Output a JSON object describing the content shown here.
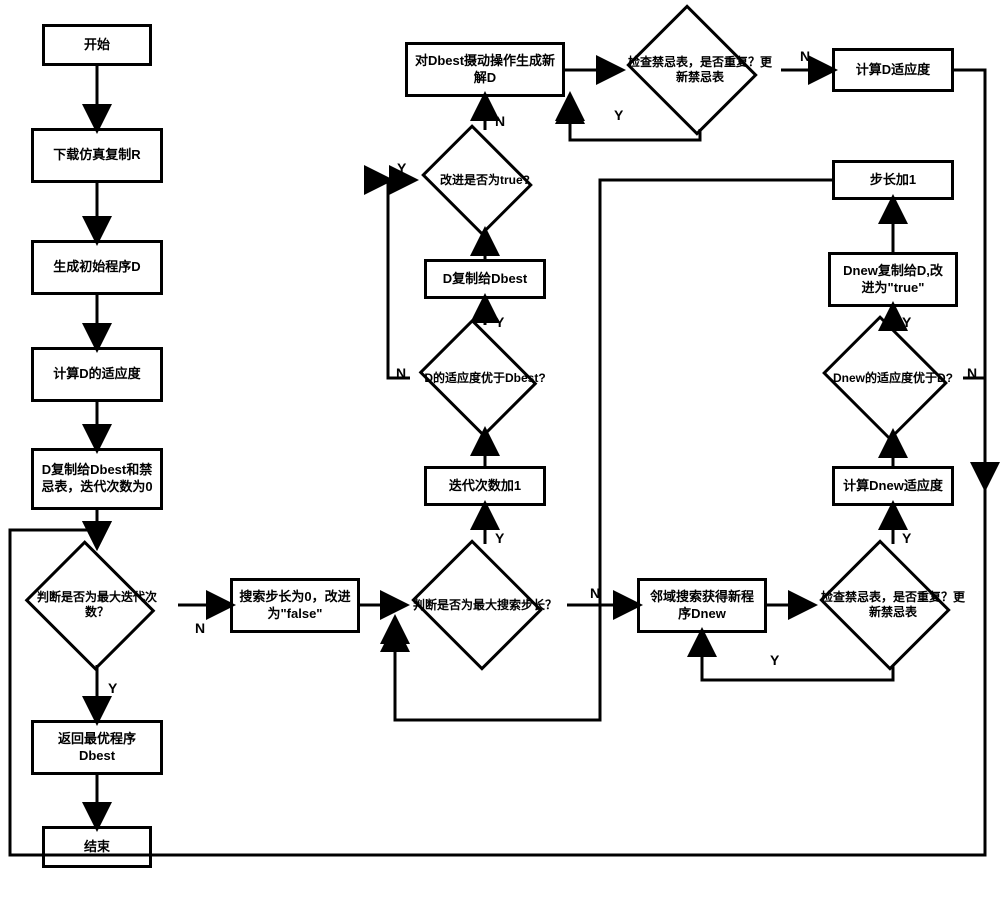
{
  "chart_data": {
    "type": "flowchart",
    "title": "",
    "nodes": [
      {
        "id": "n1",
        "shape": "rect",
        "label": "开始"
      },
      {
        "id": "n2",
        "shape": "rect",
        "label": "下载仿真复制R"
      },
      {
        "id": "n3",
        "shape": "rect",
        "label": "生成初始程序D"
      },
      {
        "id": "n4",
        "shape": "rect",
        "label": "计算D的适应度"
      },
      {
        "id": "n5",
        "shape": "rect",
        "label": "D复制给Dbest和禁忌表，迭代次数为0"
      },
      {
        "id": "n6",
        "shape": "diamond",
        "label": "判断是否为最大迭代次数？"
      },
      {
        "id": "n7",
        "shape": "rect",
        "label": "返回最优程序Dbest"
      },
      {
        "id": "n8",
        "shape": "rect",
        "label": "结束"
      },
      {
        "id": "n9",
        "shape": "rect",
        "label": "搜索步长为0，改进为\"false\""
      },
      {
        "id": "n10",
        "shape": "diamond",
        "label": "判断是否为最大搜索步长？"
      },
      {
        "id": "n11",
        "shape": "rect",
        "label": "迭代次数加1"
      },
      {
        "id": "n12",
        "shape": "diamond",
        "label": "D的适应度优于Dbest?"
      },
      {
        "id": "n13",
        "shape": "rect",
        "label": "D复制给Dbest"
      },
      {
        "id": "n14",
        "shape": "diamond",
        "label": "改进是否为true?"
      },
      {
        "id": "n15",
        "shape": "rect",
        "label": "对Dbest摄动操作生成新解D"
      },
      {
        "id": "n16",
        "shape": "diamond",
        "label": "检查禁忌表，是否重复？更新禁忌表"
      },
      {
        "id": "n17",
        "shape": "rect",
        "label": "计算D适应度"
      },
      {
        "id": "n18",
        "shape": "rect",
        "label": "邻域搜索获得新程序Dnew"
      },
      {
        "id": "n19",
        "shape": "diamond",
        "label": "检查禁忌表，是否重复？更新禁忌表"
      },
      {
        "id": "n20",
        "shape": "rect",
        "label": "计算Dnew适应度"
      },
      {
        "id": "n21",
        "shape": "diamond",
        "label": "Dnew的适应度优于D?"
      },
      {
        "id": "n22",
        "shape": "rect",
        "label": "Dnew复制给D,改进为\"true\""
      },
      {
        "id": "n23",
        "shape": "rect",
        "label": "步长加1"
      }
    ],
    "edges": [
      {
        "from": "n1",
        "to": "n2"
      },
      {
        "from": "n2",
        "to": "n3"
      },
      {
        "from": "n3",
        "to": "n4"
      },
      {
        "from": "n4",
        "to": "n5"
      },
      {
        "from": "n5",
        "to": "n6"
      },
      {
        "from": "n6",
        "to": "n7",
        "label": "Y"
      },
      {
        "from": "n6",
        "to": "n9",
        "label": "N"
      },
      {
        "from": "n7",
        "to": "n8"
      },
      {
        "from": "n9",
        "to": "n10"
      },
      {
        "from": "n10",
        "to": "n11",
        "label": "Y"
      },
      {
        "from": "n10",
        "to": "n18",
        "label": "N"
      },
      {
        "from": "n11",
        "to": "n12"
      },
      {
        "from": "n12",
        "to": "n13",
        "label": "Y"
      },
      {
        "from": "n12",
        "to": "n14",
        "label": "N"
      },
      {
        "from": "n13",
        "to": "n14"
      },
      {
        "from": "n14",
        "to": "n15",
        "label": "Y"
      },
      {
        "from": "n14",
        "to": "n9",
        "label": "N"
      },
      {
        "from": "n15",
        "to": "n16"
      },
      {
        "from": "n16",
        "to": "n17",
        "label": "N"
      },
      {
        "from": "n16",
        "to": "n15",
        "label": "Y"
      },
      {
        "from": "n17",
        "to": "n6"
      },
      {
        "from": "n18",
        "to": "n19"
      },
      {
        "from": "n19",
        "to": "n20",
        "label": "Y"
      },
      {
        "from": "n19",
        "to": "n18",
        "label": "Y"
      },
      {
        "from": "n20",
        "to": "n21"
      },
      {
        "from": "n21",
        "to": "n22",
        "label": "Y"
      },
      {
        "from": "n21",
        "to": "n23",
        "label": "N"
      },
      {
        "from": "n22",
        "to": "n23"
      },
      {
        "from": "n23",
        "to": "n10"
      }
    ]
  },
  "nodes": {
    "n1": "开始",
    "n2": "下载仿真复制R",
    "n3": "生成初始程序D",
    "n4": "计算D的适应度",
    "n5": "D复制给Dbest和禁忌表，迭代次数为0",
    "n6": "判断是否为最大迭代次数？",
    "n7": "返回最优程序Dbest",
    "n8": "结束",
    "n9": "搜索步长为0，改进为\"false\"",
    "n10": "判断是否为最大搜索步长？",
    "n11": "迭代次数加1",
    "n12": "D的适应度优于Dbest?",
    "n13": "D复制给Dbest",
    "n14": "改进是否为true?",
    "n15": "对Dbest摄动操作生成新解D",
    "n16": "检查禁忌表，是否重复？更新禁忌表",
    "n17": "计算D适应度",
    "n18": "邻域搜索获得新程序Dnew",
    "n19": "检查禁忌表，是否重复？更新禁忌表",
    "n20": "计算Dnew适应度",
    "n21": "Dnew的适应度优于D?",
    "n22": "Dnew复制给D,改进为\"true\"",
    "n23": "步长加1"
  },
  "labels": {
    "Y": "Y",
    "N": "N"
  }
}
